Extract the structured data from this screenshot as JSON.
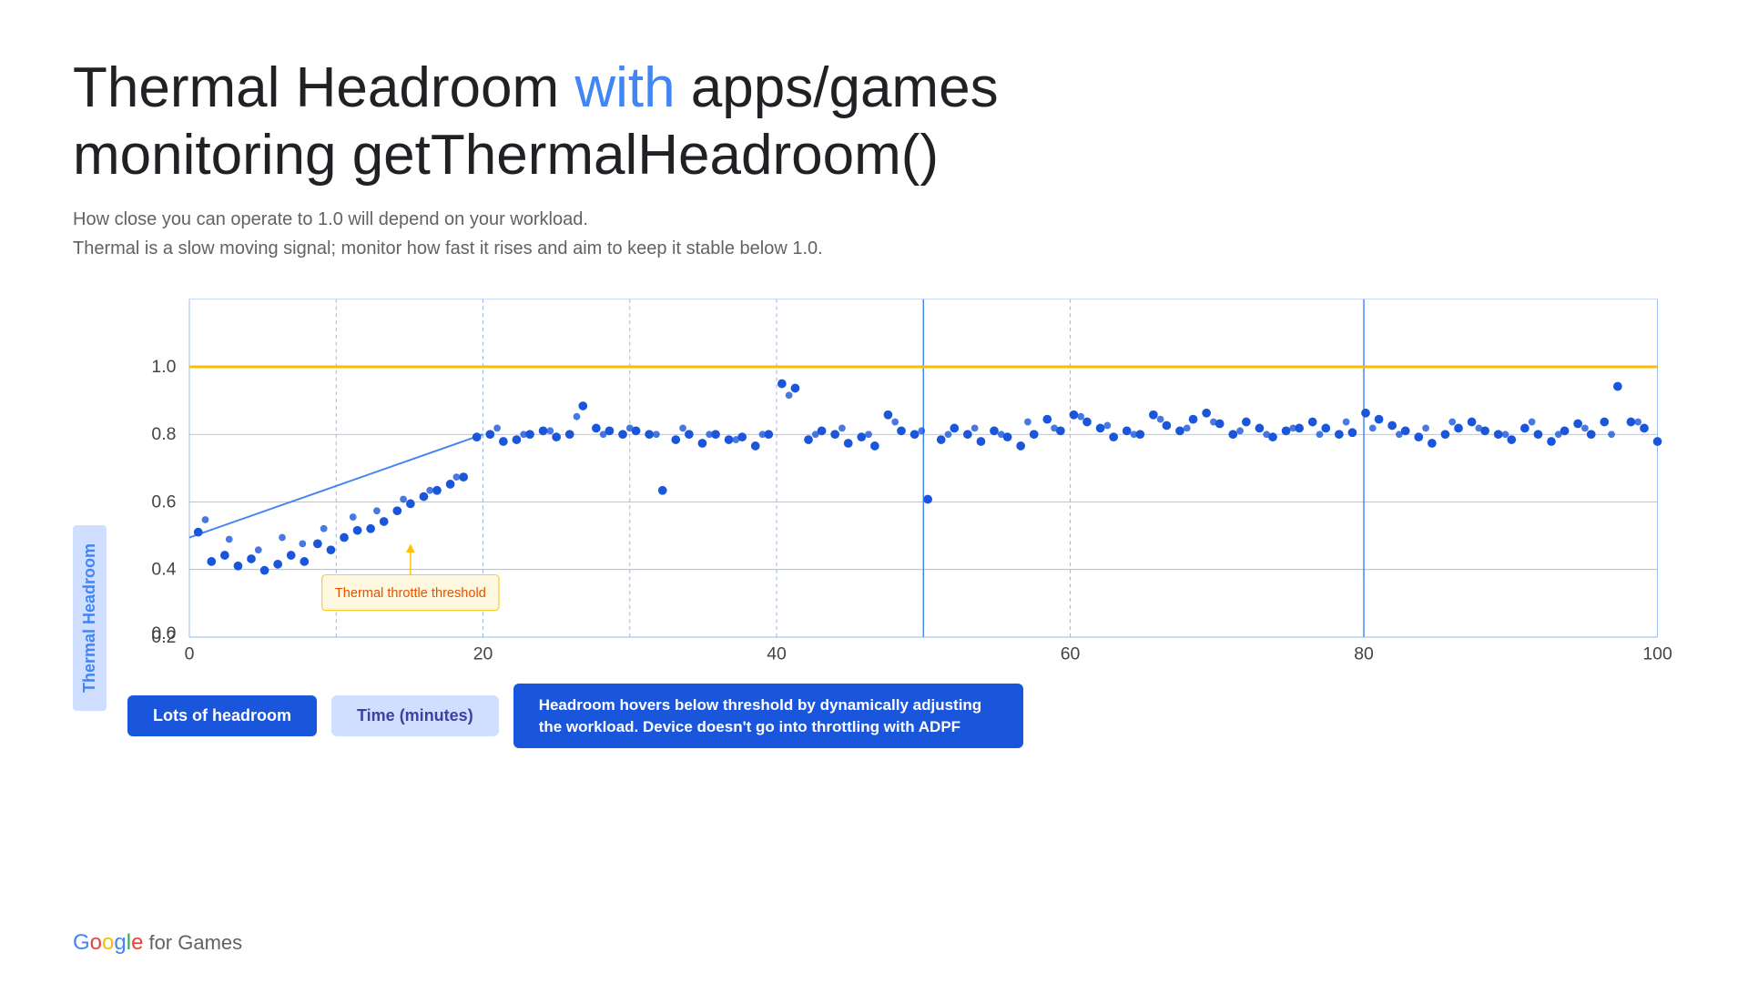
{
  "page": {
    "title_part1": "Thermal Headroom ",
    "title_with": "with",
    "title_part2": " apps/games",
    "title_line2": "monitoring getThermalHeadroom()",
    "subtitle1": "How close you can operate to 1.0 will depend on your workload.",
    "subtitle2": "Thermal is a slow moving signal; monitor how fast it rises and aim to keep it stable below 1.0.",
    "y_axis_label": "Thermal Headroom",
    "x_axis_label": "Time (minutes)",
    "thermal_throttle_label": "Thermal throttle threshold",
    "label_lots_headroom": "Lots of headroom",
    "label_time_minutes": "Time (minutes)",
    "label_headroom_hovers": "Headroom hovers below threshold by dynamically adjusting the workload. Device doesn't go into throttling with ADPF",
    "google_logo_text": "Google",
    "for_games_text": "for Games",
    "colors": {
      "accent_blue": "#4285f4",
      "golden_line": "#fbbc05",
      "dot_blue": "#1a56db",
      "grid_blue": "#90b4f0",
      "dashed_line": "#90b4f0"
    },
    "y_axis_values": [
      "0.0",
      "0.2",
      "0.4",
      "0.6",
      "0.8",
      "1.0"
    ],
    "x_axis_values": [
      "0",
      "20",
      "40",
      "60",
      "80",
      "100"
    ]
  }
}
